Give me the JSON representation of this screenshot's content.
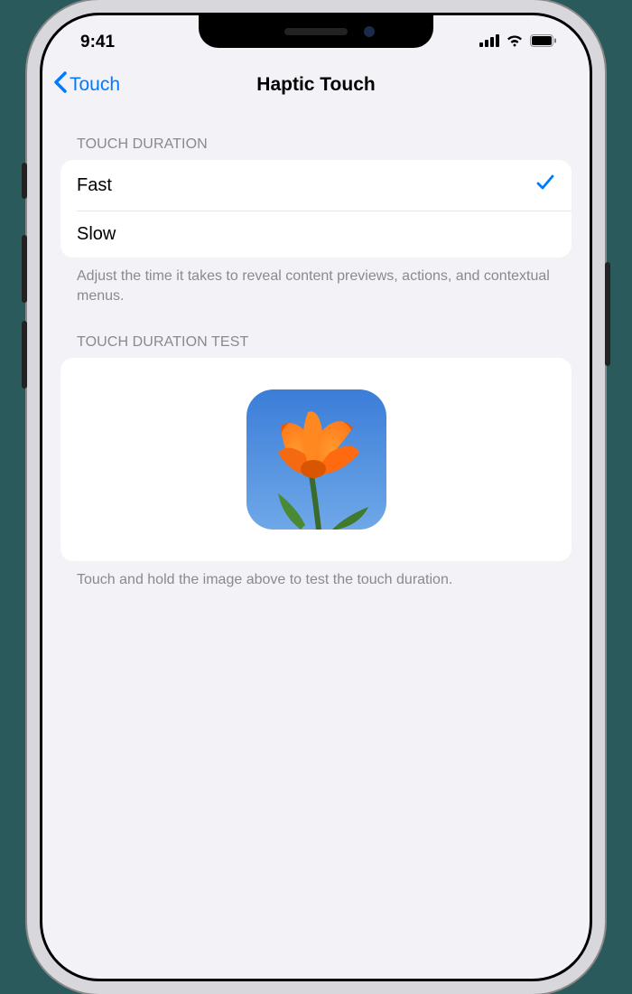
{
  "status_bar": {
    "time": "9:41"
  },
  "nav": {
    "back_label": "Touch",
    "title": "Haptic Touch"
  },
  "sections": {
    "duration": {
      "header": "TOUCH DURATION",
      "options": [
        {
          "label": "Fast",
          "selected": true
        },
        {
          "label": "Slow",
          "selected": false
        }
      ],
      "footer": "Adjust the time it takes to reveal content previews, actions, and contextual menus."
    },
    "test": {
      "header": "TOUCH DURATION TEST",
      "footer": "Touch and hold the image above to test the touch duration."
    }
  }
}
